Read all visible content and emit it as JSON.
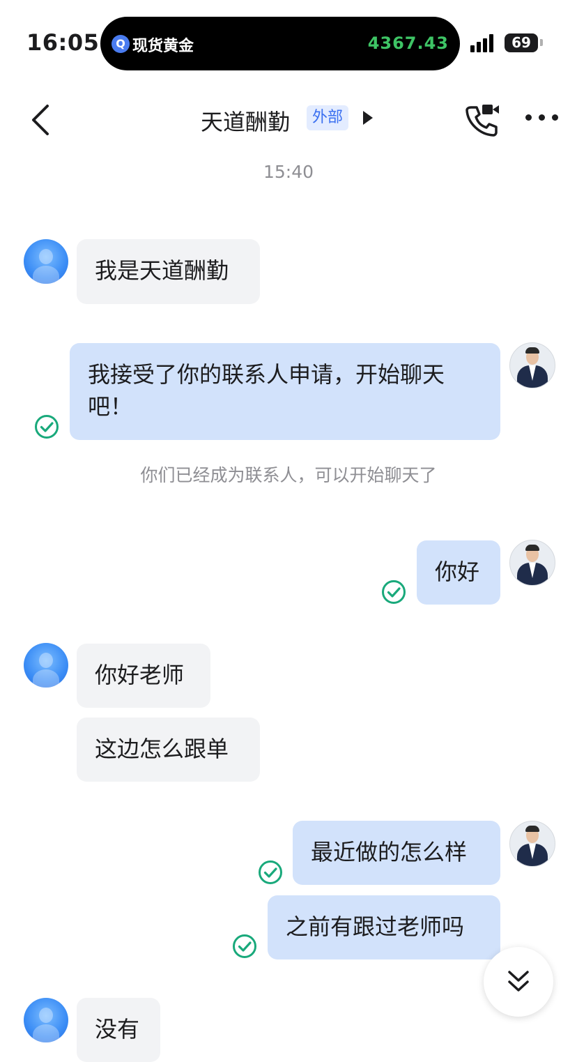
{
  "status_bar": {
    "time": "16:05",
    "island_app": "现货黄金",
    "island_price": "4367.43",
    "battery": "69"
  },
  "nav": {
    "title": "天道酬勤",
    "badge": "外部"
  },
  "chat": {
    "timestamp": "15:40",
    "system_message": "你们已经成为联系人，可以开始聊天了",
    "messages": [
      {
        "side": "in",
        "text": "我是天道酬勤"
      },
      {
        "side": "out",
        "text": "我接受了你的联系人申请，开始聊天吧！",
        "read": true
      },
      {
        "side": "out",
        "text": "你好",
        "read": true
      },
      {
        "side": "in",
        "text": "你好老师"
      },
      {
        "side": "in",
        "text": "这边怎么跟单"
      },
      {
        "side": "out",
        "text": "最近做的怎么样",
        "read": true
      },
      {
        "side": "out",
        "text": "之前有跟过老师吗",
        "read": true
      },
      {
        "side": "in",
        "text": "没有"
      }
    ]
  },
  "colors": {
    "accent": "#3a6ff0",
    "outgoing_bubble": "#d2e2fb",
    "incoming_bubble": "#f2f3f5",
    "read_check": "#19a97b",
    "price_green": "#3ec465"
  },
  "icons": {
    "back": "chevron-left-icon",
    "call": "phone-video-icon",
    "more": "more-dots-icon",
    "scroll": "double-chevron-down-icon",
    "read": "check-circle-icon"
  }
}
